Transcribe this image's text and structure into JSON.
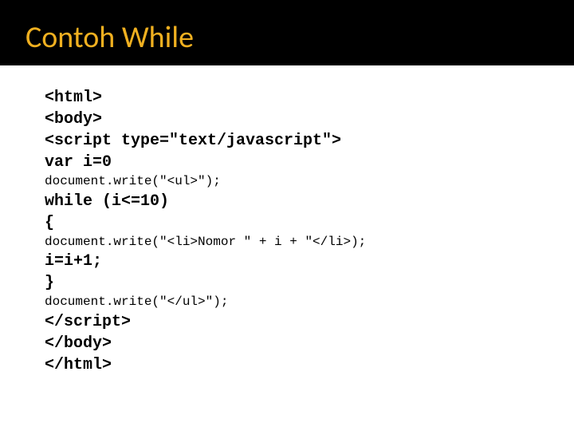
{
  "title": "Contoh While",
  "code": {
    "l1": "<html>",
    "l2": "<body>",
    "l3": "<script type=\"text/javascript\">",
    "l4": "var i=0",
    "l5": "document.write(\"<ul>\");",
    "l6": "while (i<=10)",
    "l7": "{",
    "l8": "document.write(\"<li>Nomor \" + i + \"</li>);",
    "l9": "i=i+1;",
    "l10": "}",
    "l11": "document.write(\"</ul>\");",
    "l12": "</script>",
    "l13": "</body>",
    "l14": "</html>"
  }
}
